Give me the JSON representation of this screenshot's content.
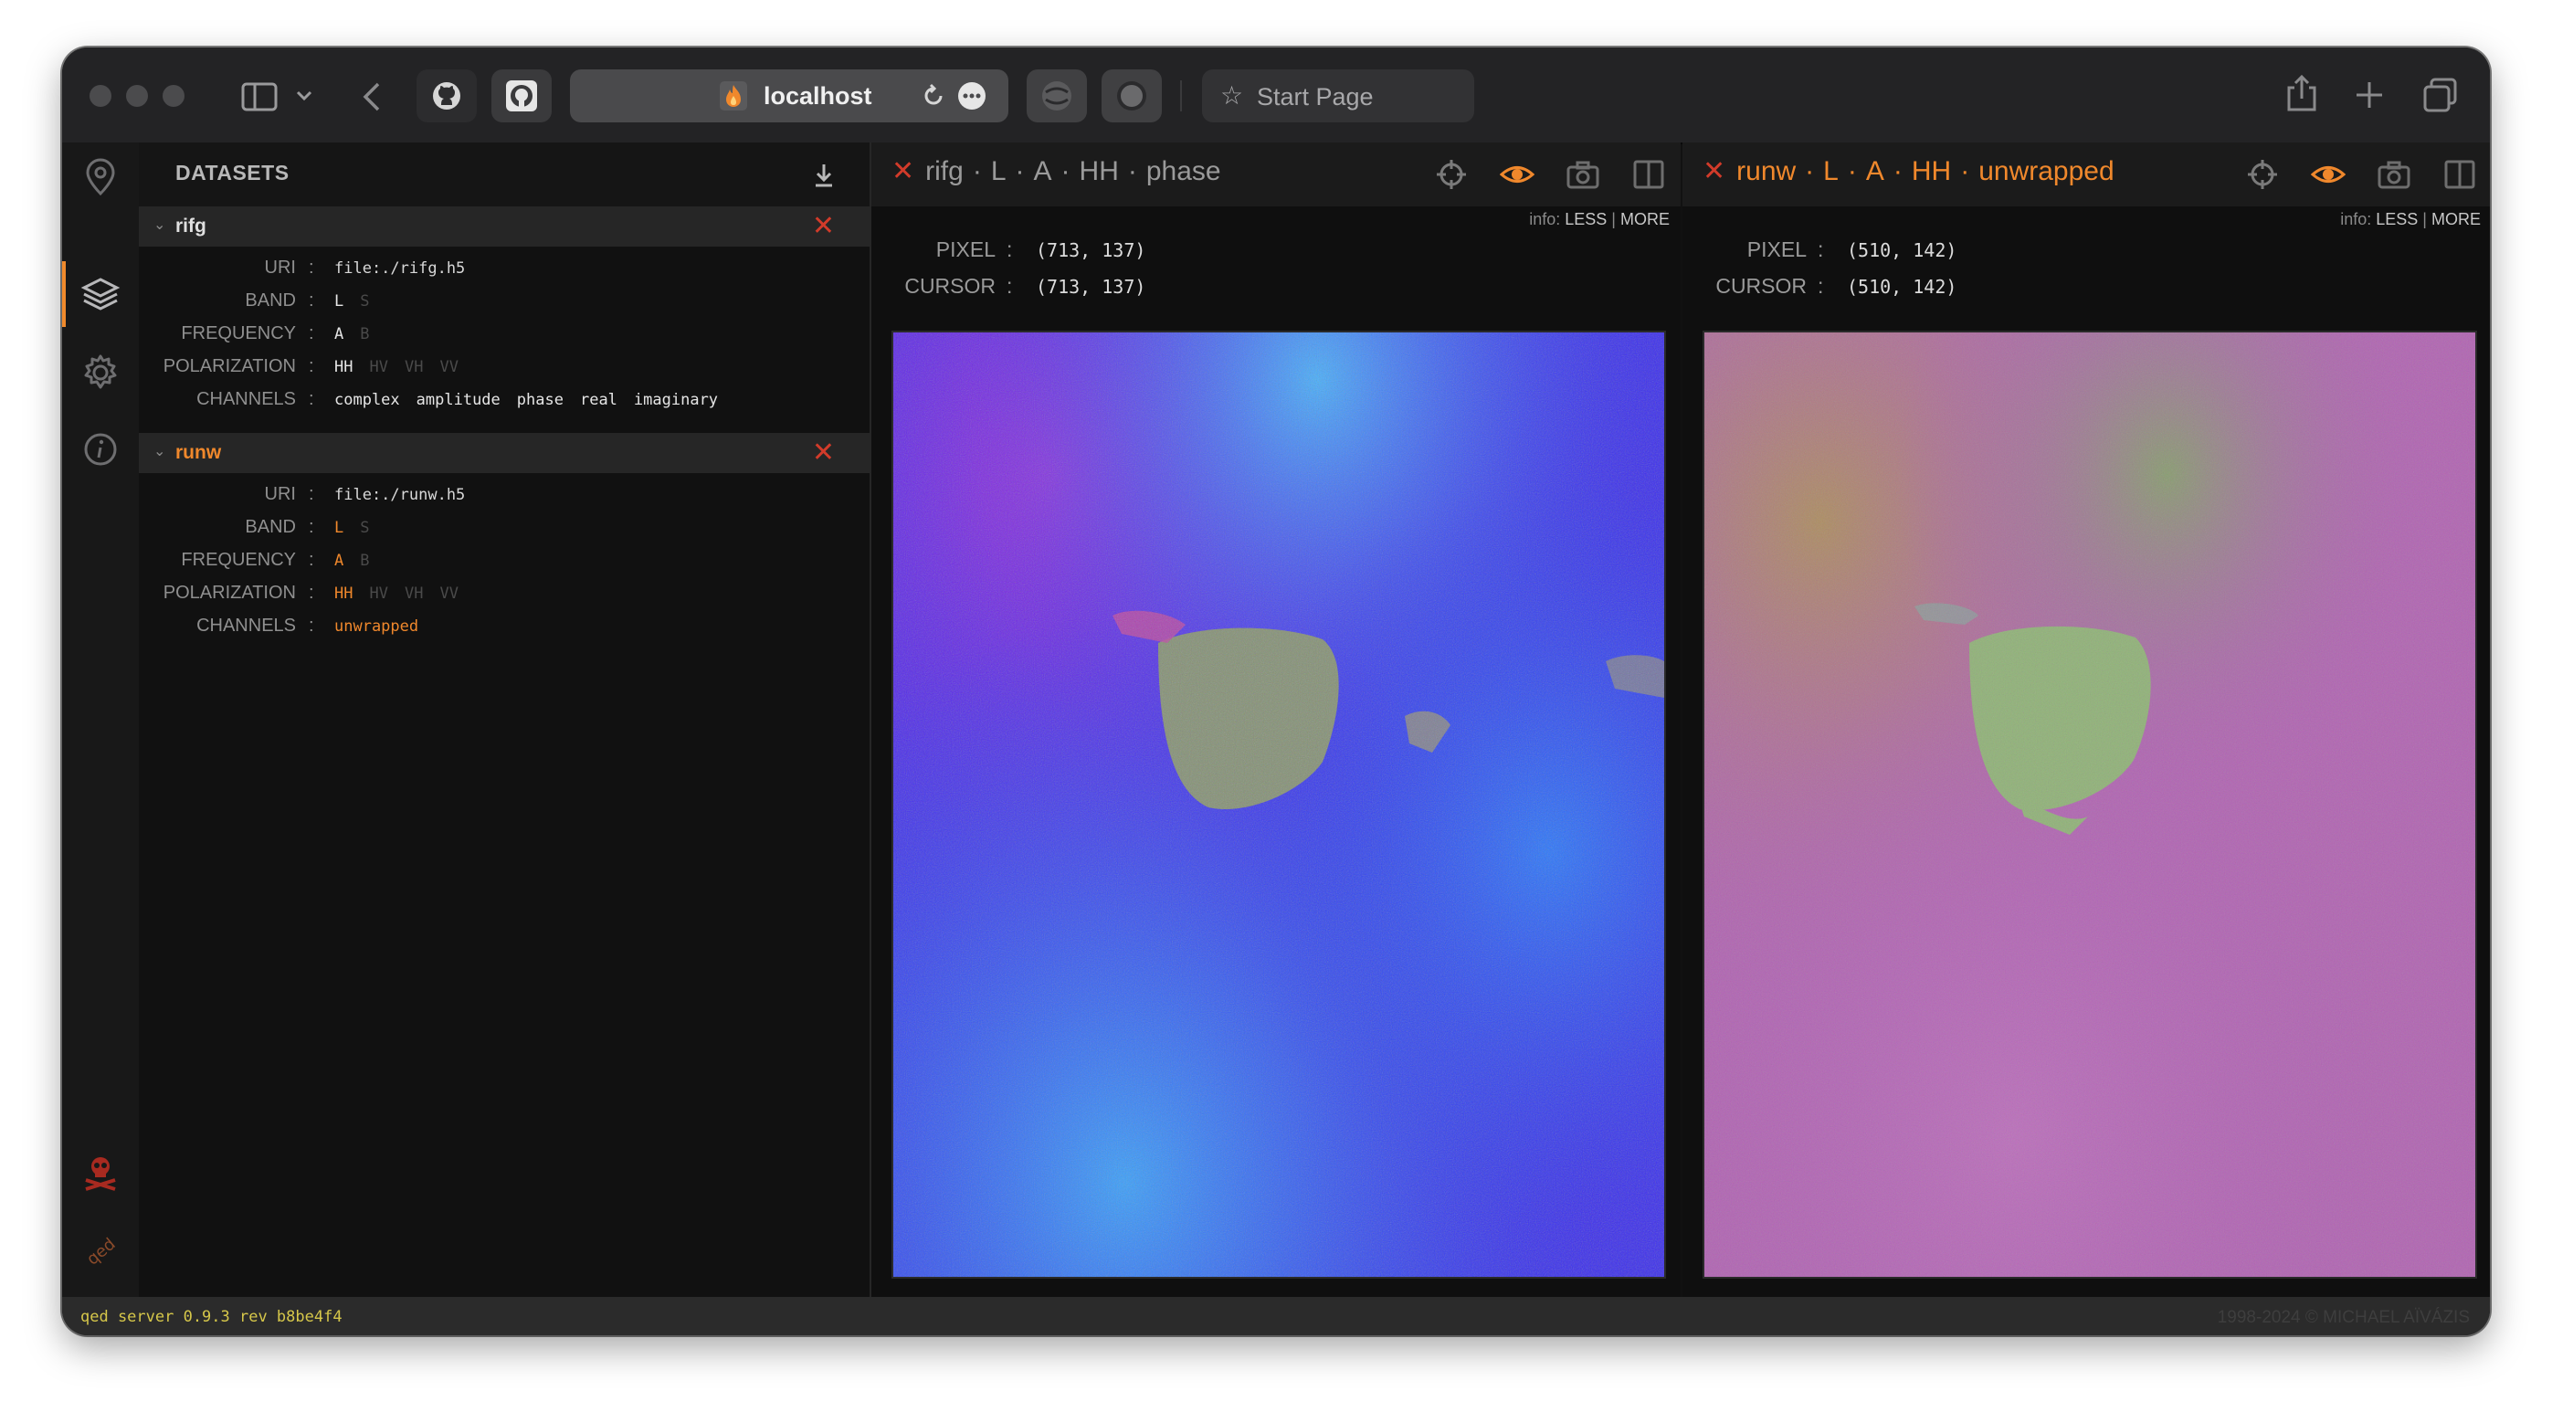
{
  "browser": {
    "url": "localhost",
    "start_page": "Start Page"
  },
  "datasets_panel": {
    "title": "DATASETS",
    "datasets": [
      {
        "name": "rifg",
        "name_color": "#e0e0e0",
        "uri": "file:./rifg.h5",
        "band": {
          "active": "L",
          "inactive": "S"
        },
        "frequency": {
          "active": "A",
          "inactive": "B"
        },
        "polarization": {
          "active": "HH",
          "inactive": [
            "HV",
            "VH",
            "VV"
          ]
        },
        "channels": [
          "complex",
          "amplitude",
          "phase",
          "real",
          "imaginary"
        ]
      },
      {
        "name": "runw",
        "name_color": "#f0882c",
        "uri": "file:./runw.h5",
        "band": {
          "active": "L",
          "inactive": "S"
        },
        "frequency": {
          "active": "A",
          "inactive": "B"
        },
        "polarization": {
          "active": "HH",
          "inactive": [
            "HV",
            "VH",
            "VV"
          ]
        },
        "channels": [
          "unwrapped"
        ]
      }
    ],
    "labels": {
      "uri": "URI",
      "band": "BAND",
      "frequency": "FREQUENCY",
      "polarization": "POLARIZATION",
      "channels": "CHANNELS",
      "colon": ":"
    }
  },
  "viewers": [
    {
      "title": {
        "dataset": "rifg",
        "band": "L",
        "freq": "A",
        "pol": "HH",
        "channel": "phase"
      },
      "title_color": "#9a9a9a",
      "sep": "·",
      "info": {
        "label": "info:",
        "less": "LESS",
        "divider": "|",
        "more": "MORE"
      },
      "pixel_label": "PIXEL",
      "pixel_value": "(713, 137)",
      "cursor_label": "CURSOR",
      "cursor_value": "(713, 137)",
      "colon": ":"
    },
    {
      "title": {
        "dataset": "runw",
        "band": "L",
        "freq": "A",
        "pol": "HH",
        "channel": "unwrapped"
      },
      "title_color": "#f0882c",
      "sep": "·",
      "info": {
        "label": "info:",
        "less": "LESS",
        "divider": "|",
        "more": "MORE"
      },
      "pixel_label": "PIXEL",
      "pixel_value": "(510, 142)",
      "cursor_label": "CURSOR",
      "cursor_value": "(510, 142)",
      "colon": ":"
    }
  ],
  "status": {
    "left": "qed server 0.9.3 rev b8be4f4",
    "right": "1998-2024 © MICHAEL AÏVÁZIS"
  },
  "colors": {
    "accent": "#f0882c",
    "close": "#d23b2a",
    "status_text": "#d6c74a"
  }
}
